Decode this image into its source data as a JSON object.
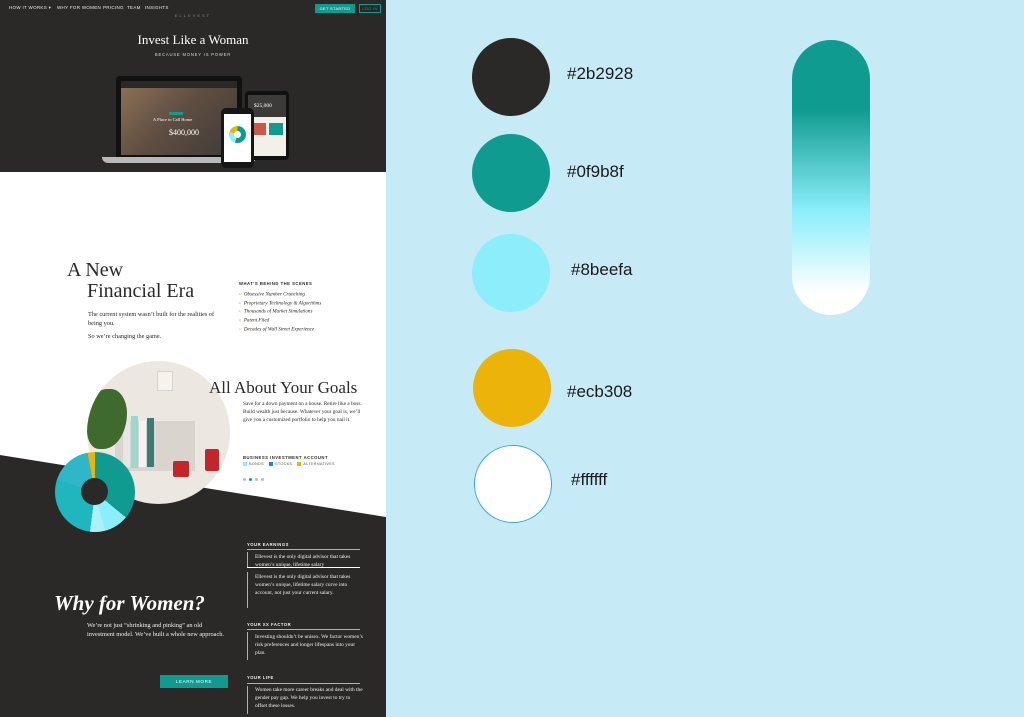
{
  "nav": {
    "items": [
      "HOW IT WORKS ▾",
      "WHY FOR WOMEN",
      "PRICING",
      "TEAM",
      "INSIGHTS"
    ],
    "get_started": "GET STARTED",
    "login": "LOG IN",
    "brand": "ELLEVEST"
  },
  "hero": {
    "title": "Invest Like a Woman",
    "subtitle": "BECAUSE MONEY IS POWER",
    "laptop_overlay": "A Place to Call Home",
    "laptop_amount": "$400,000",
    "tablet_amount": "$25,000"
  },
  "era": {
    "title_line1": "A New",
    "title_line2": "Financial Era",
    "body": "The current system wasn’t built for the realities of being you.",
    "body2": "So we’re changing the game.",
    "behind_heading": "WHAT’S BEHIND THE SCENES",
    "behind_items": [
      "Obsessive Number Crunching",
      "Proprietary Technology & Algorithms",
      "Thousands of Market Simulations",
      "Patent Filed",
      "Decades of Wall Street Experience"
    ]
  },
  "goals": {
    "title": "All About Your Goals",
    "body": "Save for a down payment on a house. Retire like a boss. Build wealth just because. Whatever your goal is, we’ll give you a customized portfolio to help you nail it.",
    "account_heading": "BUSINESS INVESTMENT ACCOUNT",
    "legend": [
      {
        "label": "BONDS",
        "color": "#8beefa"
      },
      {
        "label": "STOCKS",
        "color": "#0f9b8f"
      },
      {
        "label": "ALTERNATIVES",
        "color": "#ecb308"
      }
    ],
    "slide_count": 4,
    "slide_active": 2
  },
  "why": {
    "title": "Why for Women?",
    "body": "We’re not just “shrinking and pinking” an old investment model. We’ve built a whole new approach.",
    "learn_more": "LEARN MORE",
    "earnings_heading": "YOUR EARNINGS",
    "earnings_preview": "Ellevest is the only digital advisor that takes women’s unique, lifetime salary",
    "earnings_text": "Ellevest is the only digital advisor that takes women’s unique, lifetime salary curve into account, not just your current salary.",
    "xx_heading": "YOUR XX FACTOR",
    "xx_text": "Investing shouldn’t be unisex. We factor women’s risk preferences and longer lifespans into your plan.",
    "life_heading": "YOUR LIFE",
    "life_text": "Women take more career breaks and deal with the gender pay gap. We help you invest to try to offset these losses."
  },
  "palette": {
    "swatches": [
      {
        "hex": "#2b2928",
        "label": "#2b2928"
      },
      {
        "hex": "#0f9b8f",
        "label": "#0f9b8f"
      },
      {
        "hex": "#8beefa",
        "label": "#8beefa"
      },
      {
        "hex": "#ecb308",
        "label": "#ecb308"
      },
      {
        "hex": "#ffffff",
        "label": "#ffffff"
      }
    ]
  }
}
